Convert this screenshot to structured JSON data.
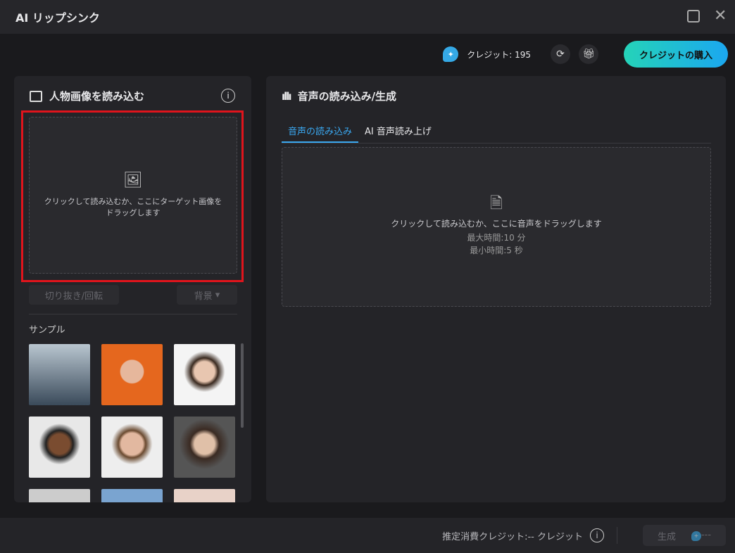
{
  "title": "AI リップシンク",
  "topbar": {
    "credits_label": "クレジット: 195",
    "buy_label": "クレジットの購入"
  },
  "left": {
    "title": "人物画像を読み込む",
    "drop_text": "クリックして読み込むか、ここにターゲット画像をドラッグします",
    "crop_label": "切り抜き/回転",
    "background_label": "背景",
    "samples_label": "サンプル"
  },
  "right": {
    "title": "音声の読み込み/生成",
    "tabs": [
      "音声の読み込み",
      "AI 音声読み上げ"
    ],
    "drop_text": "クリックして読み込むか、ここに音声をドラッグします",
    "max_time": "最大時間:10 分",
    "min_time": "最小時間:5 秒"
  },
  "footer": {
    "estimate": "推定消費クレジット:-- クレジット",
    "generate": "生成",
    "cost": "---"
  },
  "colors": {
    "accent": "#1ba7f0",
    "highlight": "#e0141c"
  }
}
